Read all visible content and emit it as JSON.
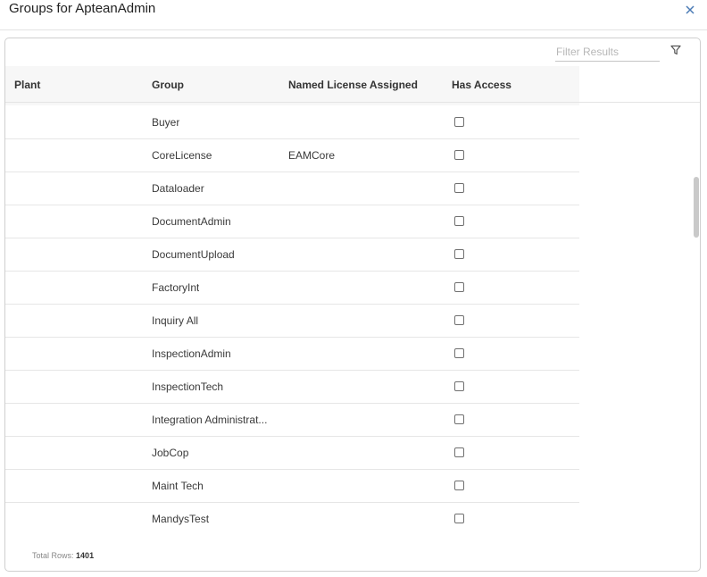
{
  "dialog": {
    "title": "Groups for ApteanAdmin",
    "close_icon": "close-icon"
  },
  "filter": {
    "placeholder": "Filter Results",
    "value": "",
    "icon": "filter-icon"
  },
  "table": {
    "columns": [
      "Plant",
      "Group",
      "Named License Assigned",
      "Has Access"
    ],
    "rows": [
      {
        "plant": "",
        "group": "Buyer",
        "license": "",
        "has_access": false
      },
      {
        "plant": "",
        "group": "CoreLicense",
        "license": "EAMCore",
        "has_access": false
      },
      {
        "plant": "",
        "group": "Dataloader",
        "license": "",
        "has_access": false
      },
      {
        "plant": "",
        "group": "DocumentAdmin",
        "license": "",
        "has_access": false
      },
      {
        "plant": "",
        "group": "DocumentUpload",
        "license": "",
        "has_access": false
      },
      {
        "plant": "",
        "group": "FactoryInt",
        "license": "",
        "has_access": false
      },
      {
        "plant": "",
        "group": "Inquiry All",
        "license": "",
        "has_access": false
      },
      {
        "plant": "",
        "group": "InspectionAdmin",
        "license": "",
        "has_access": false
      },
      {
        "plant": "",
        "group": "InspectionTech",
        "license": "",
        "has_access": false
      },
      {
        "plant": "",
        "group": "Integration Administrat...",
        "license": "",
        "has_access": false
      },
      {
        "plant": "",
        "group": "JobCop",
        "license": "",
        "has_access": false
      },
      {
        "plant": "",
        "group": "Maint Tech",
        "license": "",
        "has_access": false
      },
      {
        "plant": "",
        "group": "MandysTest",
        "license": "",
        "has_access": false
      }
    ]
  },
  "footer": {
    "total_label": "Total Rows:",
    "total_value": "1401"
  },
  "colors": {
    "accent": "#4a7bb5",
    "header_bg": "#f7f7f7",
    "border": "#cfcfcf"
  }
}
